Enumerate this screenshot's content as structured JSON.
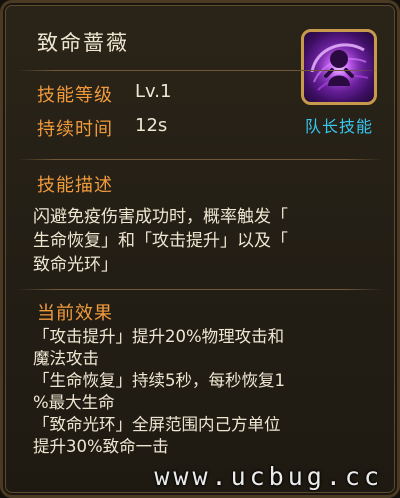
{
  "skill": {
    "name": "致命蔷薇",
    "level_label": "技能等级",
    "level_value": "Lv.1",
    "duration_label": "持续时间",
    "duration_value": "12s",
    "icon": "rose-burst-icon",
    "tag": "队长技能"
  },
  "description": {
    "title": "技能描述",
    "lines": [
      "闪避免疫伤害成功时，概率触发「",
      "生命恢复」和「攻击提升」以及「",
      "致命光环」"
    ]
  },
  "effects": {
    "title": "当前效果",
    "lines": [
      "「攻击提升」提升20%物理攻击和",
      "魔法攻击",
      "「生命恢复」持续5秒，每秒恢复1",
      "%最大生命",
      "「致命光环」全屏范围内己方单位",
      "提升30%致命一击"
    ]
  },
  "watermark": "www.ucbug.cc",
  "colors": {
    "label_orange": "#f19b3d",
    "text_cream": "#efe6d2",
    "tag_cyan": "#37c7f0",
    "icon_purple": "#7d27b8",
    "frame_gold": "#c79a4c"
  }
}
